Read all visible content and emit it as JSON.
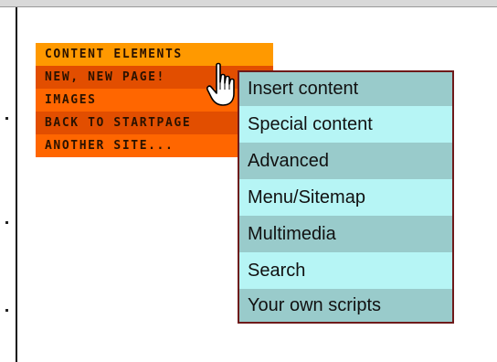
{
  "main_menu": {
    "items": [
      {
        "label": "CONTENT ELEMENTS"
      },
      {
        "label": "NEW, NEW PAGE!"
      },
      {
        "label": "IMAGES"
      },
      {
        "label": "BACK TO STARTPAGE"
      },
      {
        "label": "ANOTHER SITE..."
      }
    ]
  },
  "submenu": {
    "items": [
      {
        "label": "Insert content"
      },
      {
        "label": "Special content"
      },
      {
        "label": "Advanced"
      },
      {
        "label": "Menu/Sitemap"
      },
      {
        "label": "Multimedia"
      },
      {
        "label": "Search"
      },
      {
        "label": "Your own scripts"
      }
    ]
  },
  "colors": {
    "menu_orange": "#ff9900",
    "menu_dark_orange": "#e24e00",
    "menu_mid_orange": "#ff6600",
    "submenu_dark": "#99cbcb",
    "submenu_light": "#b6f5f5",
    "submenu_border": "#6e1a1a"
  },
  "icons": {
    "cursor": "hand-pointer-icon"
  }
}
